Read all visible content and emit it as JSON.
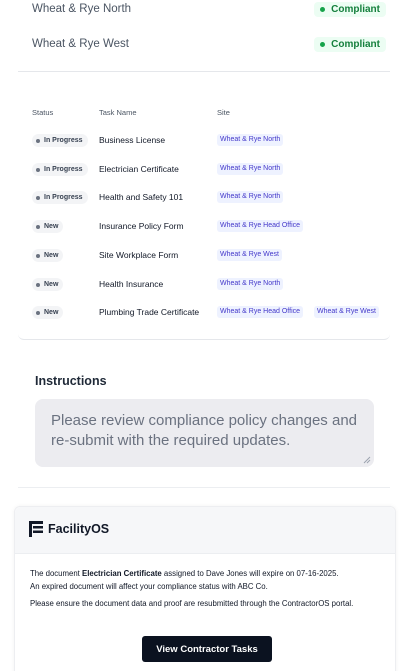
{
  "sites": [
    {
      "name": "Wheat & Rye North",
      "status": "Compliant"
    },
    {
      "name": "Wheat & Rye West",
      "status": "Compliant"
    }
  ],
  "tasks": {
    "headers": {
      "status": "Status",
      "task": "Task Name",
      "site": "Site"
    },
    "rows": [
      {
        "status": "In Progress",
        "task": "Business License",
        "sites": [
          "Wheat & Rye North"
        ]
      },
      {
        "status": "In Progress",
        "task": "Electrician Certificate",
        "sites": [
          "Wheat & Rye North"
        ]
      },
      {
        "status": "In Progress",
        "task": "Health and Safety 101",
        "sites": [
          "Wheat & Rye North"
        ]
      },
      {
        "status": "New",
        "task": "Insurance Policy Form",
        "sites": [
          "Wheat & Rye Head Office"
        ]
      },
      {
        "status": "New",
        "task": "Site Workplace Form",
        "sites": [
          "Wheat & Rye West"
        ]
      },
      {
        "status": "New",
        "task": "Health Insurance",
        "sites": [
          "Wheat & Rye North"
        ]
      },
      {
        "status": "New",
        "task": "Plumbing Trade Certificate",
        "sites": [
          "Wheat & Rye Head Office",
          "Wheat & Rye West"
        ]
      }
    ]
  },
  "instructions": {
    "title": "Instructions",
    "text": "Please review compliance policy changes and re-submit with the required updates."
  },
  "email": {
    "brand": "FacilityOS",
    "line1_pre": "The document ",
    "line1_doc": "Electrician Certificate",
    "line1_post": " assigned to Dave Jones will expire on 07-16-2025.",
    "line2": "An expired document will affect your compliance status with ABC Co.",
    "line3": "Please ensure the document data and proof are resubmitted through the ContractorOS portal.",
    "cta_label": "View Contractor Tasks"
  },
  "colors": {
    "compliant_text": "#15803d",
    "site_pill_text": "#4338ca",
    "cta_bg": "#0b1220"
  }
}
